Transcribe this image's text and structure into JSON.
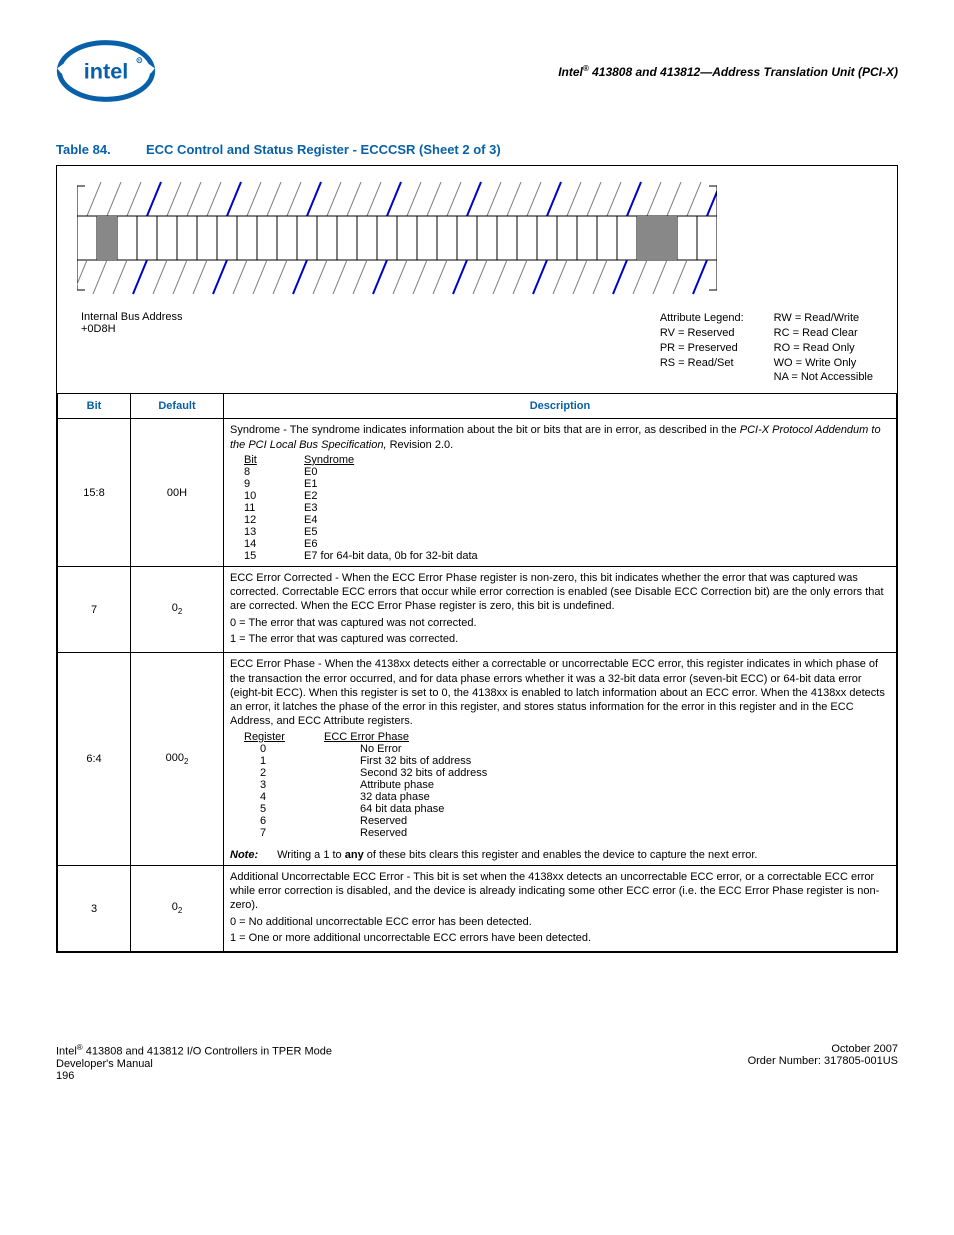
{
  "header": {
    "product": "Intel",
    "reg": "®",
    "title_rest": " 413808 and 413812—Address Translation Unit (PCI-X)"
  },
  "caption": {
    "label": "Table 84.",
    "title": "ECC Control and Status Register - ECCCSR (Sheet 2 of 3)"
  },
  "diagram": {
    "addr_label": "Internal Bus Address",
    "addr_value": "+0D8H",
    "legend_title": "Attribute Legend:",
    "legend_left": [
      "RV = Reserved",
      "PR = Preserved",
      "RS = Read/Set"
    ],
    "legend_right": [
      "RW = Read/Write",
      "RC = Read Clear",
      "RO = Read Only",
      "WO = Write Only",
      "NA = Not Accessible"
    ]
  },
  "table_headers": {
    "bit": "Bit",
    "default": "Default",
    "description": "Description"
  },
  "rows": [
    {
      "bit": "15:8",
      "def": "00H",
      "desc_intro1": "Syndrome - The syndrome indicates information about the bit or bits that are in error, as described in the ",
      "desc_intro_italic": "PCI-X Protocol Addendum to the PCI Local Bus Specification,",
      "desc_intro2": " Revision 2.0.",
      "hdr1": "Bit",
      "hdr2": "Syndrome",
      "items": [
        {
          "a": "8",
          "b": "E0"
        },
        {
          "a": "9",
          "b": "E1"
        },
        {
          "a": "10",
          "b": "E2"
        },
        {
          "a": "11",
          "b": "E3"
        },
        {
          "a": "12",
          "b": "E4"
        },
        {
          "a": "13",
          "b": "E5"
        },
        {
          "a": "14",
          "b": "E6"
        },
        {
          "a": "15",
          "b": "E7 for 64-bit data, 0b for 32-bit data"
        }
      ]
    },
    {
      "bit": "7",
      "def_html": "0<sub>2</sub>",
      "p1": "ECC Error Corrected - When the ECC Error Phase register is non-zero, this bit indicates whether the error that was captured was corrected. Correctable ECC errors that occur while error correction is enabled (see Disable ECC Correction bit) are the only errors that are corrected. When the ECC Error Phase register is zero, this bit is undefined.",
      "p2": "0 =  The error that was captured was not corrected.",
      "p3": "1 =  The error that was captured was corrected."
    },
    {
      "bit": "6:4",
      "def_html": "000<sub>2</sub>",
      "p1": "ECC Error Phase - When the 4138xx detects either a correctable or uncorrectable ECC error, this register indicates in which phase of the transaction the error occurred, and for data phase errors whether it was a 32-bit data error (seven-bit ECC) or 64-bit data error (eight-bit ECC). When this register is set to 0, the 4138xx is enabled to latch information about an ECC error. When the 4138xx detects an error, it latches the phase of the error in this register, and stores status information for the error in this register and in the ECC Address, and ECC Attribute registers.",
      "hdr1": "Register",
      "hdr2": "ECC Error Phase",
      "items": [
        {
          "a": "0",
          "b": "No Error"
        },
        {
          "a": "1",
          "b": "First 32 bits of address"
        },
        {
          "a": "2",
          "b": "Second 32 bits of address"
        },
        {
          "a": "3",
          "b": "Attribute phase"
        },
        {
          "a": "4",
          "b": "32 data phase"
        },
        {
          "a": "5",
          "b": "64 bit data phase"
        },
        {
          "a": "6",
          "b": "Reserved"
        },
        {
          "a": "7",
          "b": "Reserved"
        }
      ],
      "note_label": "Note:",
      "note_pre": "Writing a 1 to ",
      "note_bold": "any",
      "note_post": " of these bits clears this register and enables the device to capture the next error."
    },
    {
      "bit": "3",
      "def_html": "0<sub>2</sub>",
      "p1": "Additional Uncorrectable ECC Error - This bit is set when the 4138xx detects an uncorrectable ECC error, or a correctable ECC error while error correction is disabled, and the device is already indicating some other ECC error (i.e. the ECC Error Phase register is non-zero).",
      "p2": "0 =  No additional uncorrectable ECC error has been detected.",
      "p3": "1 =  One or more additional uncorrectable ECC errors have been detected."
    }
  ],
  "footer": {
    "left1": "Intel® 413808 and 413812 I/O Controllers in TPER Mode",
    "left2": "Developer's Manual",
    "left3": "196",
    "right1": "October 2007",
    "right2": "Order Number: 317805-001US"
  }
}
